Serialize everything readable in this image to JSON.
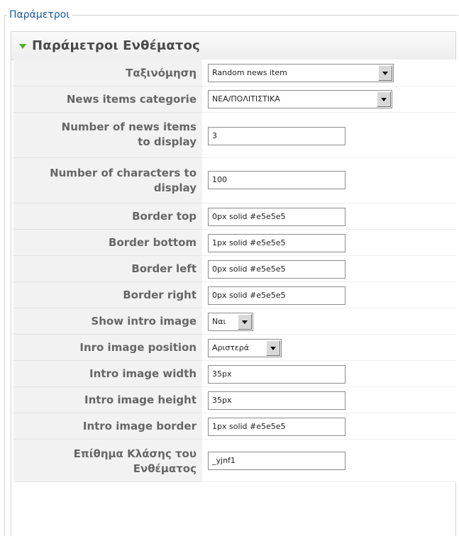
{
  "fieldset": {
    "legend": "Παράμετροι"
  },
  "panel": {
    "title": "Παράμετροι Ενθέματος",
    "toggle_icon": "triangle-down-icon",
    "toggle_color": "#4caf2a"
  },
  "colors": {
    "legend_text": "#1b57a6",
    "label_bg": "#f2f2f2",
    "label_text": "#666666"
  },
  "fields": {
    "ordering": {
      "label": "Ταξινόμηση",
      "value": "Random news item"
    },
    "category": {
      "label": "News items categorie",
      "value": "ΝΕΑ/ΠΟΛΙΤΙΣΤΙΚΑ"
    },
    "num_items": {
      "label_line1": "Number of news items",
      "label_line2": "to display",
      "value": "3"
    },
    "num_chars": {
      "label_line1": "Number of characters to",
      "label_line2": "display",
      "value": "100"
    },
    "border_top": {
      "label": "Border top",
      "value": "0px solid #e5e5e5"
    },
    "border_bottom": {
      "label": "Border bottom",
      "value": "1px solid #e5e5e5"
    },
    "border_left": {
      "label": "Border left",
      "value": "0px solid #e5e5e5"
    },
    "border_right": {
      "label": "Border right",
      "value": "0px solid #e5e5e5"
    },
    "show_intro_image": {
      "label": "Show intro image",
      "value": "Ναι"
    },
    "intro_image_position": {
      "label": "Inro image position",
      "value": "Αριστερά"
    },
    "intro_image_width": {
      "label": "Intro image width",
      "value": "35px"
    },
    "intro_image_height": {
      "label": "Intro image height",
      "value": "35px"
    },
    "intro_image_border": {
      "label": "Intro image border",
      "value": "1px solid #e5e5e5"
    },
    "module_class_suffix": {
      "label_line1": "Επίθημα Κλάσης του",
      "label_line2": "Ενθέματος",
      "value": "_yjnf1"
    }
  }
}
